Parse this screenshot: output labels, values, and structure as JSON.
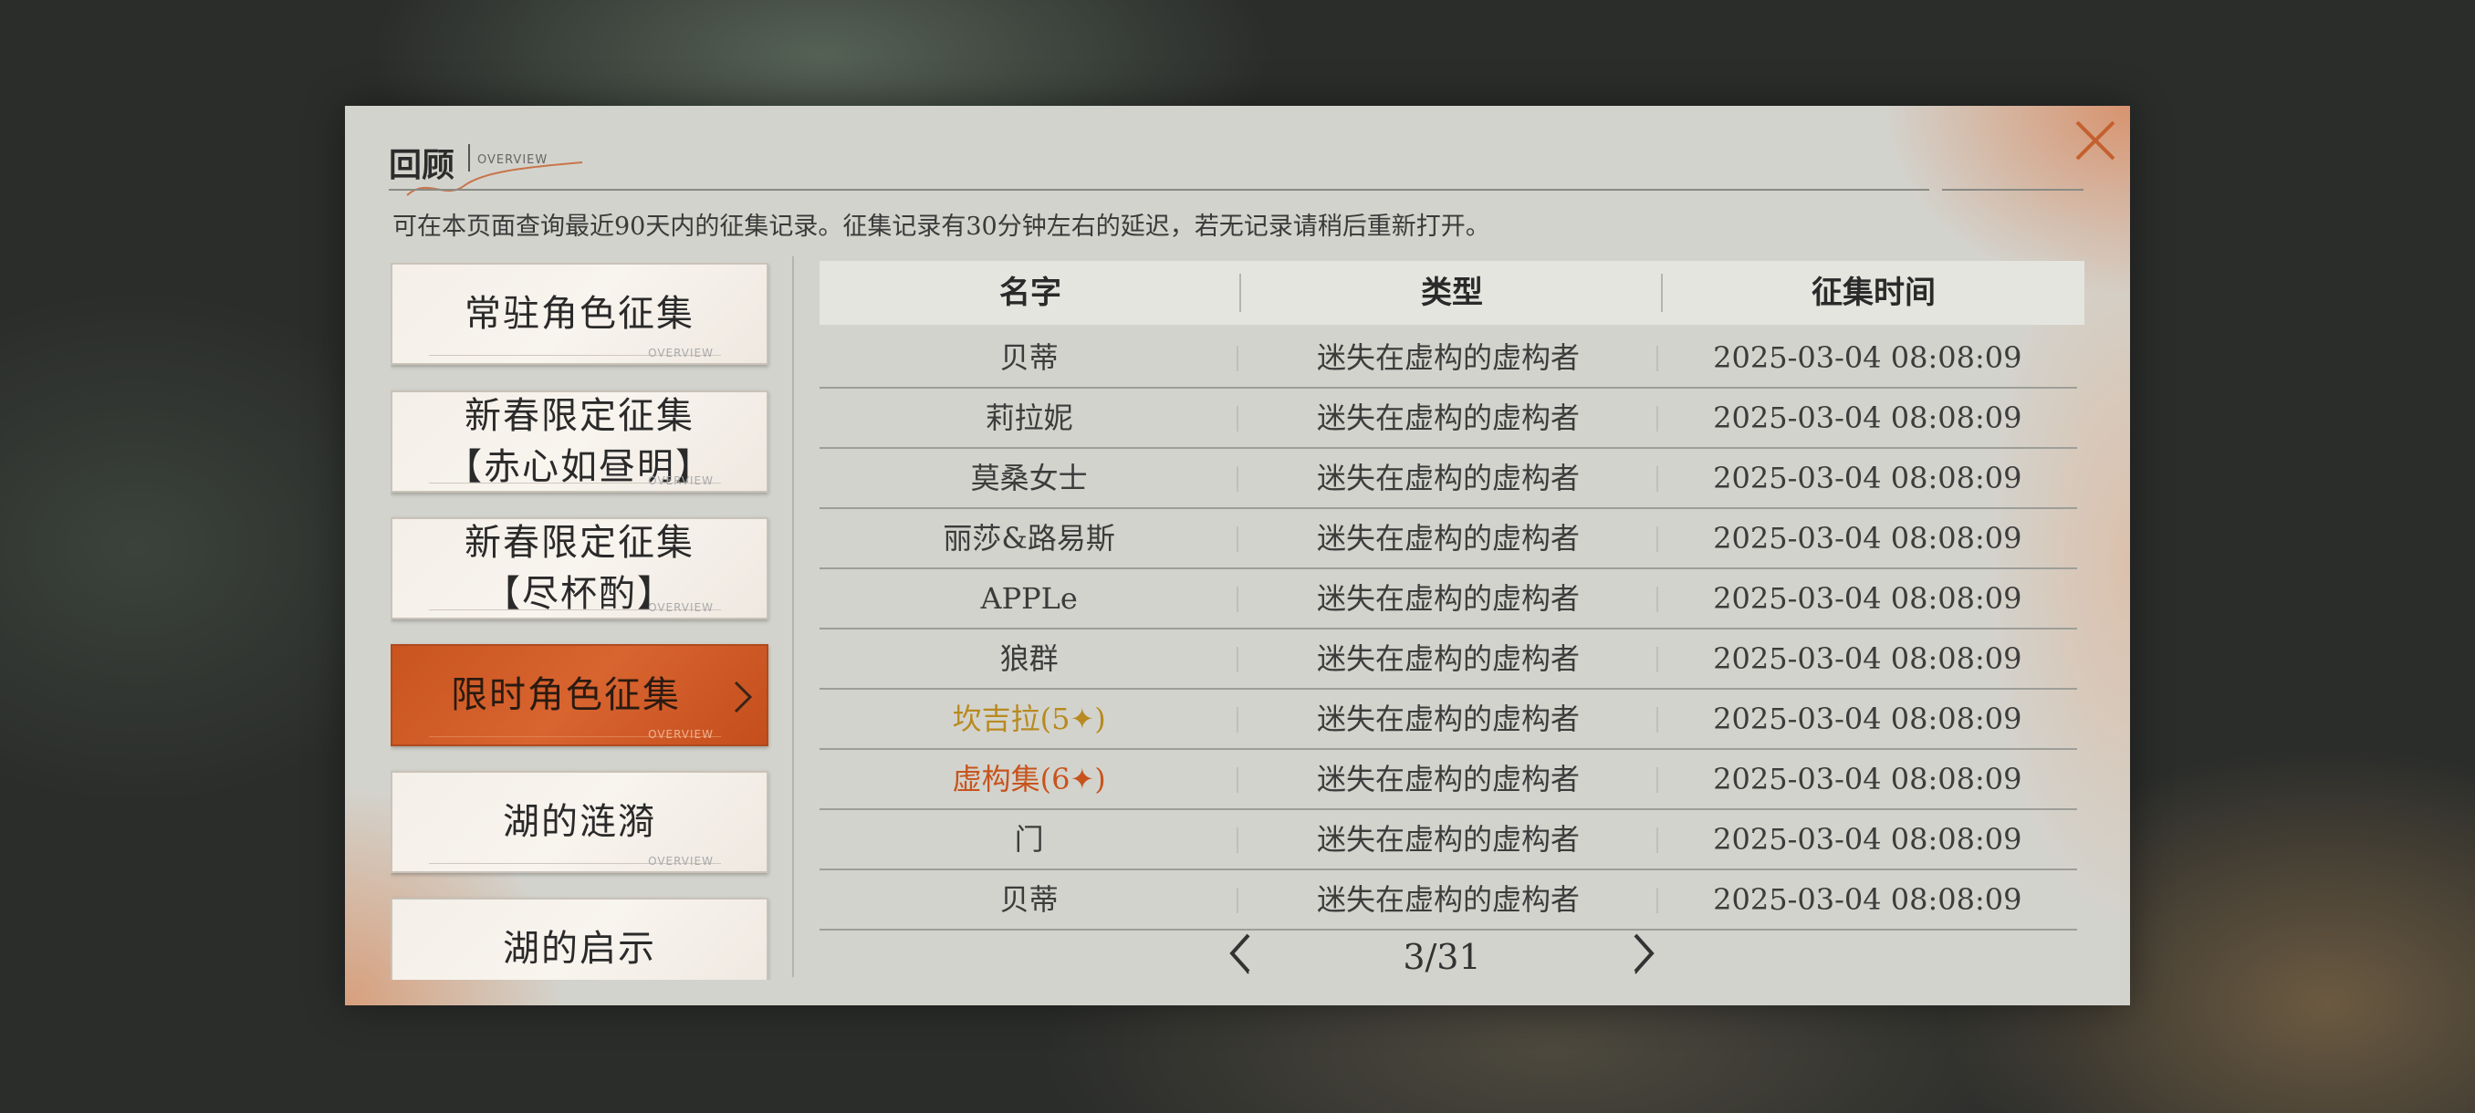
{
  "dialog": {
    "title": "回顾",
    "subtitle": "OVERVIEW",
    "info": "可在本页面查询最近90天内的征集记录。征集记录有30分钟左右的延迟，若无记录请稍后重新打开。"
  },
  "sidebar": {
    "items": [
      {
        "label": "常驻角色征集"
      },
      {
        "label": "新春限定征集\n【赤心如昼明】"
      },
      {
        "label": "新春限定征集\n【尽杯酌】"
      },
      {
        "label": "限时角色征集",
        "active": true
      },
      {
        "label": "湖的涟漪"
      },
      {
        "label": "湖的启示"
      }
    ],
    "card_watermark": "OVERVIEW"
  },
  "table": {
    "headers": [
      "名字",
      "类型",
      "征集时间"
    ],
    "rows": [
      {
        "name": "贝蒂",
        "type": "迷失在虚构的虚构者",
        "time": "2025-03-04 08:08:09"
      },
      {
        "name": "莉拉妮",
        "type": "迷失在虚构的虚构者",
        "time": "2025-03-04 08:08:09"
      },
      {
        "name": "莫桑女士",
        "type": "迷失在虚构的虚构者",
        "time": "2025-03-04 08:08:09"
      },
      {
        "name": "丽莎&路易斯",
        "type": "迷失在虚构的虚构者",
        "time": "2025-03-04 08:08:09"
      },
      {
        "name": "APPLe",
        "type": "迷失在虚构的虚构者",
        "time": "2025-03-04 08:08:09"
      },
      {
        "name": "狼群",
        "type": "迷失在虚构的虚构者",
        "time": "2025-03-04 08:08:09"
      },
      {
        "name": "坎吉拉(5✦)",
        "type": "迷失在虚构的虚构者",
        "time": "2025-03-04 08:08:09",
        "rarity": "gold"
      },
      {
        "name": "虚构集(6✦)",
        "type": "迷失在虚构的虚构者",
        "time": "2025-03-04 08:08:09",
        "rarity": "orange"
      },
      {
        "name": "门",
        "type": "迷失在虚构的虚构者",
        "time": "2025-03-04 08:08:09"
      },
      {
        "name": "贝蒂",
        "type": "迷失在虚构的虚构者",
        "time": "2025-03-04 08:08:09"
      }
    ]
  },
  "pagination": {
    "text": "3/31",
    "current": 3,
    "total": 31
  },
  "colors": {
    "accent": "#d05a24",
    "gold": "#b88a20",
    "orange": "#c7541d"
  },
  "icons": {
    "close": "close-icon",
    "prev": "chevron-left-icon",
    "next": "chevron-right-icon",
    "active_arrow": "chevron-right-icon"
  }
}
